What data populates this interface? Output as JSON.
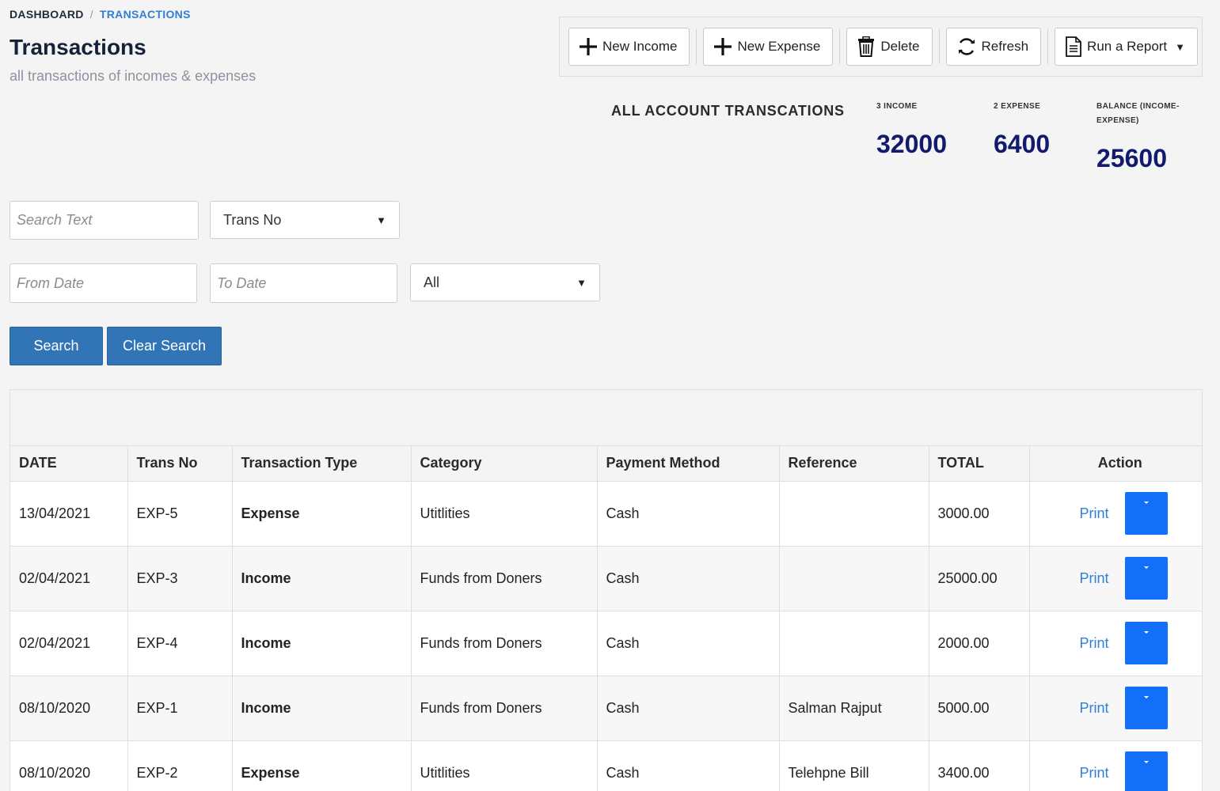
{
  "breadcrumb": {
    "home": "DASHBOARD",
    "separator": "/",
    "current": "TRANSACTIONS"
  },
  "header": {
    "title": "Transactions",
    "subtitle": "all transactions of incomes & expenses"
  },
  "toolbar": {
    "new_income": "New Income",
    "new_expense": "New Expense",
    "delete": "Delete",
    "refresh": "Refresh",
    "run_report": "Run a Report",
    "run_report_caret": "▼"
  },
  "summary": {
    "title": "ALL ACCOUNT TRANSCATIONS",
    "income_label": "3 INCOME",
    "income_value": "32000",
    "expense_label": "2 EXPENSE",
    "expense_value": "6400",
    "balance_label": "BALANCE (INCOME-EXPENSE)",
    "balance_value": "25600"
  },
  "filters": {
    "search_placeholder": "Search Text",
    "search_by": "Trans No",
    "from_date_placeholder": "From Date",
    "to_date_placeholder": "To Date",
    "type_filter": "All",
    "caret": "▼",
    "search_button": "Search",
    "clear_button": "Clear Search"
  },
  "table": {
    "columns": [
      "DATE",
      "Trans No",
      "Transaction Type",
      "Category",
      "Payment Method",
      "Reference",
      "TOTAL",
      "Action"
    ],
    "print_label": "Print",
    "rows": [
      {
        "date": "13/04/2021",
        "trans_no": "EXP-5",
        "type": "Expense",
        "category": "Utitlities",
        "method": "Cash",
        "reference": "",
        "total": "3000.00"
      },
      {
        "date": "02/04/2021",
        "trans_no": "EXP-3",
        "type": "Income",
        "category": "Funds from Doners",
        "method": "Cash",
        "reference": "",
        "total": "25000.00"
      },
      {
        "date": "02/04/2021",
        "trans_no": "EXP-4",
        "type": "Income",
        "category": "Funds from Doners",
        "method": "Cash",
        "reference": "",
        "total": "2000.00"
      },
      {
        "date": "08/10/2020",
        "trans_no": "EXP-1",
        "type": "Income",
        "category": "Funds from Doners",
        "method": "Cash",
        "reference": "Salman Rajput",
        "total": "5000.00"
      },
      {
        "date": "08/10/2020",
        "trans_no": "EXP-2",
        "type": "Expense",
        "category": "Utitlities",
        "method": "Cash",
        "reference": "Telehpne Bill",
        "total": "3400.00"
      }
    ]
  },
  "colors": {
    "accent": "#2f7fd6",
    "primary_button": "#3175b6",
    "action_button": "#1170f7",
    "stat_value": "#121a6e"
  }
}
